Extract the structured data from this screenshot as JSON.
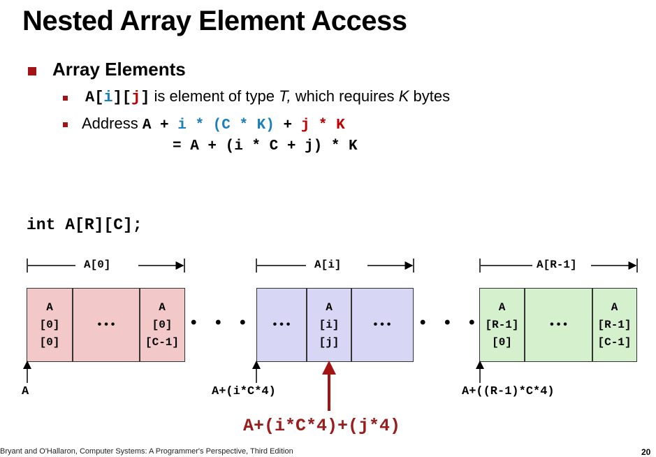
{
  "title": "Nested Array Element Access",
  "section": "Array Elements",
  "bullet1": {
    "code": "A[i][j]",
    "text": " is element of type ",
    "T": "T,",
    "mid": " which requires ",
    "K": "K",
    "end": " bytes"
  },
  "bullet2": {
    "prefix": "Address ",
    "eq1_a": "A + ",
    "eq1_b": "i * (C * K)",
    "eq1_c": " + ",
    "eq1_d": "j * K",
    "eq2": "= A + (i * C + j) * K"
  },
  "declaration": "int A[R][C];",
  "groups": [
    {
      "label": "A[0]",
      "cells": [
        [
          "A",
          "[0]",
          "[0]"
        ],
        [
          "•••"
        ],
        [
          "A",
          "[0]",
          "[C-1]"
        ]
      ]
    },
    {
      "label": "A[i]",
      "cells": [
        [
          "•••"
        ],
        [
          "A",
          "[i]",
          "[j]"
        ],
        [
          "•••"
        ]
      ]
    },
    {
      "label": "A[R-1]",
      "cells": [
        [
          "A",
          "[R-1]",
          "[0]"
        ],
        [
          "•••"
        ],
        [
          "A",
          "[R-1]",
          "[C-1]"
        ]
      ]
    }
  ],
  "ellipsis": "• • •",
  "addresses": {
    "a0": "A",
    "ai": "A+(i*C*4)",
    "ar": "A+((R-1)*C*4)"
  },
  "element_address": "A+(i*C*4)+(j*4)",
  "footer": "Bryant and O'Hallaron, Computer Systems: A Programmer's Perspective, Third Edition",
  "page_number": "20",
  "colors": {
    "accent": "#a31515",
    "index_i": "#1a7fbf",
    "index_j": "#c00000",
    "row0": "#f2c8c8",
    "rowi": "#d7d6f4",
    "rowR": "#d5f0cd"
  }
}
